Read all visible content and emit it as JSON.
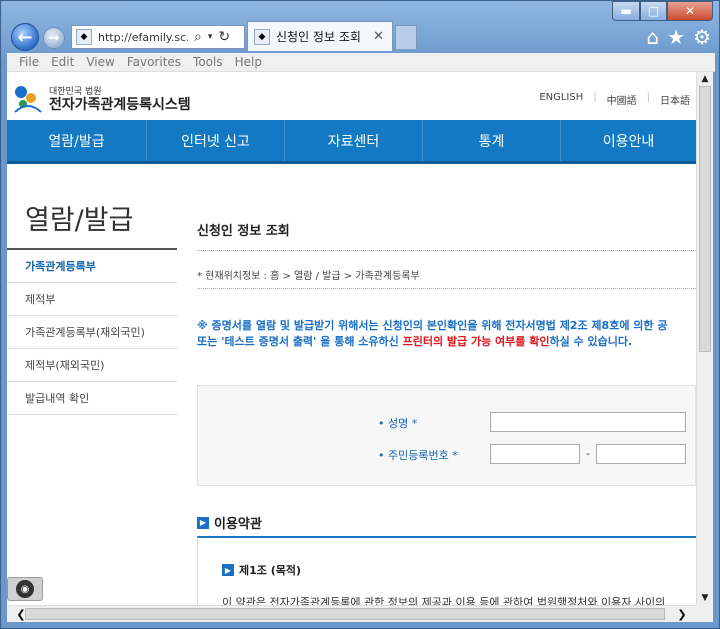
{
  "browser": {
    "back_icon": "back-arrow-icon",
    "forward_icon": "forward-arrow-icon",
    "address_url": "http://efamily.sc...",
    "tab_title": "신청인 정보 조회",
    "tab_close": "✕",
    "menu": [
      "File",
      "Edit",
      "View",
      "Favorites",
      "Tools",
      "Help"
    ],
    "accent": "#6b98cc"
  },
  "site": {
    "logo_small": "대한민국 법원",
    "logo_main": "전자가족관계등록시스템",
    "languages": [
      "ENGLISH",
      "中國語",
      "日本語"
    ],
    "gnb": [
      "열람/발급",
      "인터넷 신고",
      "자료센터",
      "통계",
      "이용안내"
    ],
    "gnb_color": "#1279c2"
  },
  "sidebar": {
    "title": "열람/발급",
    "items": [
      {
        "label": "가족관계등록부",
        "active": true
      },
      {
        "label": "제적부",
        "active": false
      },
      {
        "label": "가족관계등록부(재외국민)",
        "active": false
      },
      {
        "label": "제적부(재외국민)",
        "active": false
      },
      {
        "label": "발급내역 확인",
        "active": false
      }
    ]
  },
  "content": {
    "title": "신청인 정보 조회",
    "location": "* 현재위치정보 : 홈 > 열람 / 발급 > 가족관계등록부",
    "notice_line1": "※ 증명서를 열람 및 발급받기 위해서는 신청인의 본인확인을 위해 전자서명법 제2조 제8호에 의한 공",
    "notice_line2_a": "또는 '테스트 증명서 출력' 을 통해 소유하신 ",
    "notice_line2_red": "프린터의 발급 가능 여부를 확인",
    "notice_line2_b": "하실 수 있습니다.",
    "form": {
      "name_label": "• 성명 *",
      "rrn_label": "• 주민등록번호 *",
      "rrn_dash": "-"
    },
    "terms_section": "이용약관",
    "article_title": "제1조 (목적)",
    "article_text": "이 약관은 전자가족관계등록에 관한 정보의 제공과 이용 등에 관하여 법원행정처와 이용자 사이의"
  }
}
